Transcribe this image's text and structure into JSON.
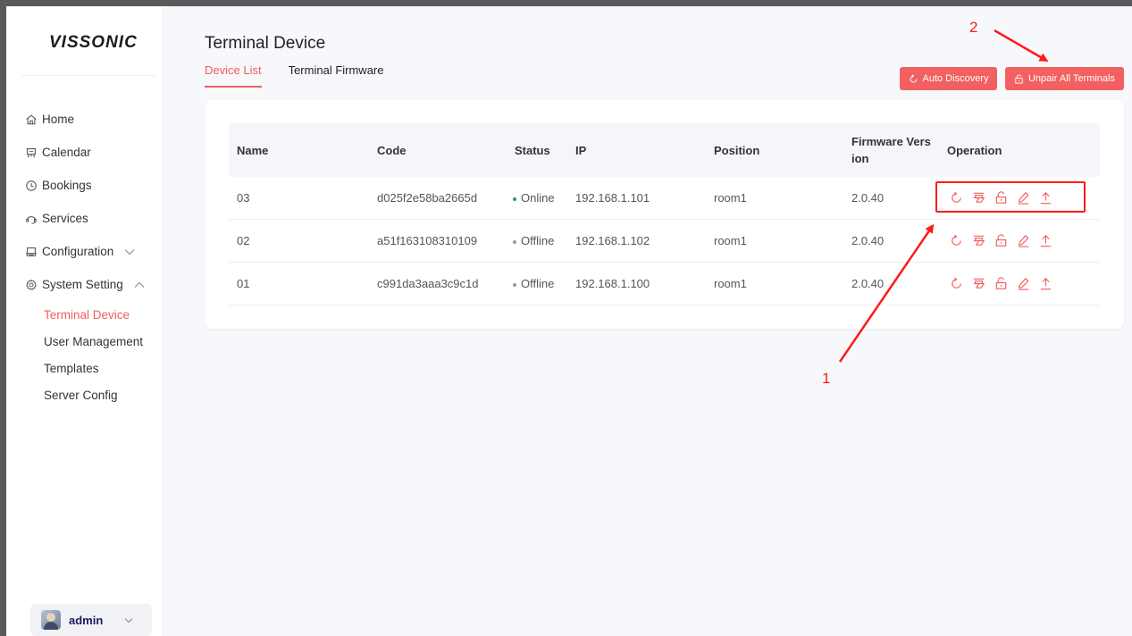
{
  "app": {
    "logo": "VISSONIC"
  },
  "nav": {
    "items": [
      {
        "label": "Home",
        "icon": "home-icon"
      },
      {
        "label": "Calendar",
        "icon": "calendar-icon"
      },
      {
        "label": "Bookings",
        "icon": "clock-icon"
      },
      {
        "label": "Services",
        "icon": "services-icon"
      },
      {
        "label": "Configuration",
        "icon": "configuration-icon",
        "expanded": false
      },
      {
        "label": "System Setting",
        "icon": "settings-icon",
        "expanded": true
      }
    ],
    "sub_items": [
      {
        "label": "Terminal Device",
        "active": true
      },
      {
        "label": "User Management",
        "active": false
      },
      {
        "label": "Templates",
        "active": false
      },
      {
        "label": "Server Config",
        "active": false
      }
    ]
  },
  "user": {
    "name": "admin"
  },
  "page": {
    "title": "Terminal Device",
    "tabs": [
      {
        "label": "Device List",
        "active": true
      },
      {
        "label": "Terminal Firmware",
        "active": false
      }
    ],
    "buttons": {
      "auto_discovery": "Auto Discovery",
      "unpair_all": "Unpair All Terminals"
    }
  },
  "table": {
    "headers": {
      "name": "Name",
      "code": "Code",
      "status": "Status",
      "ip": "IP",
      "position": "Position",
      "firmware": "Firmware Vers ion",
      "operation": "Operation"
    },
    "rows": [
      {
        "name": "03",
        "code": "d025f2e58ba2665d",
        "status": "Online",
        "ip": "192.168.1.101",
        "position": "room1",
        "firmware": "2.0.40"
      },
      {
        "name": "02",
        "code": "a51f163108310109",
        "status": "Offline",
        "ip": "192.168.1.102",
        "position": "room1",
        "firmware": "2.0.40"
      },
      {
        "name": "01",
        "code": "c991da3aaa3c9c1d",
        "status": "Offline",
        "ip": "192.168.1.100",
        "position": "room1",
        "firmware": "2.0.40"
      }
    ],
    "operation_icons": [
      "refresh-icon",
      "projector-icon",
      "unlock-icon",
      "edit-icon",
      "upload-icon"
    ]
  },
  "annotations": {
    "label_1": "1",
    "label_2": "2"
  },
  "colors": {
    "accent": "#f25c5c",
    "online": "#2e9e4f",
    "offline": "#999999",
    "annotation": "#ff1a1a"
  }
}
